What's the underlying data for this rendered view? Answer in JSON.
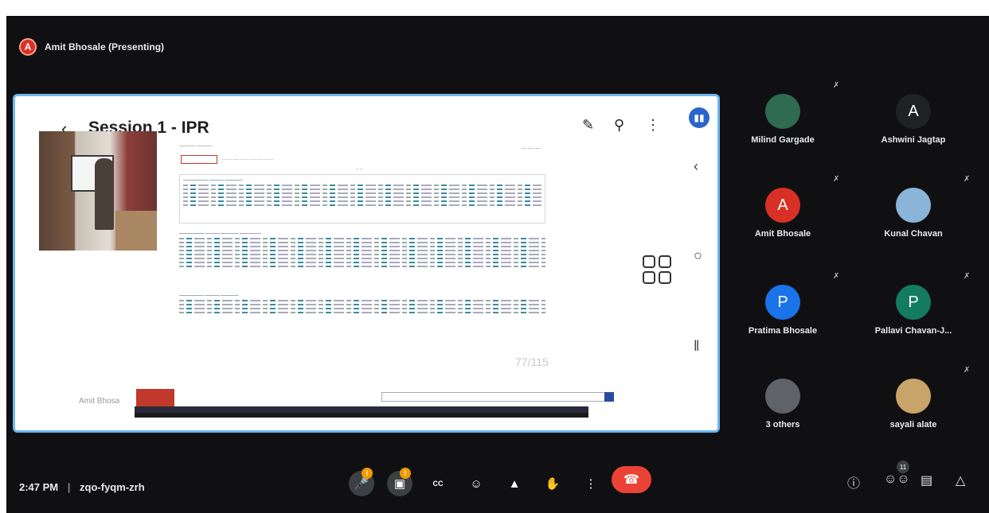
{
  "presenter": {
    "initial": "A",
    "label": "Amit Bhosale (Presenting)"
  },
  "shared_screen": {
    "back_icon": "chevron-left",
    "title": "Session 1 - IPR",
    "toolbar_icons": [
      "edit-icon",
      "search-icon",
      "more-vert-icon"
    ],
    "page_counter": "77/115",
    "presenter_name_watermark": "Amit Bhosa"
  },
  "participants": [
    {
      "name": "Milind Gargade",
      "initial": "",
      "avatar_color": "#2e6b4f"
    },
    {
      "name": "Ashwini Jagtap",
      "initial": "A",
      "avatar_color": "#202124"
    },
    {
      "name": "Amit Bhosale",
      "initial": "A",
      "avatar_color": "#d93025"
    },
    {
      "name": "Kunal Chavan",
      "initial": "",
      "avatar_color": "#8ab4d8"
    },
    {
      "name": "Pratima Bhosale",
      "initial": "P",
      "avatar_color": "#1a73e8"
    },
    {
      "name": "Pallavi Chavan-J...",
      "initial": "P",
      "avatar_color": "#137c5e"
    },
    {
      "name": "3 others",
      "initial": "",
      "avatar_color": "#5f6368"
    },
    {
      "name": "sayali alate",
      "initial": "",
      "avatar_color": "#c8a46a"
    }
  ],
  "meeting": {
    "time": "2:47 PM",
    "separator": "|",
    "code": "zqo-fyqm-zrh"
  },
  "controls": {
    "mic_badge": "!",
    "cam_badge": "!",
    "captions_icon": "CC",
    "people_count": "11"
  },
  "colors": {
    "accent": "#1a73e8",
    "end_call": "#ea4335",
    "share_border": "#6fb6f0"
  }
}
